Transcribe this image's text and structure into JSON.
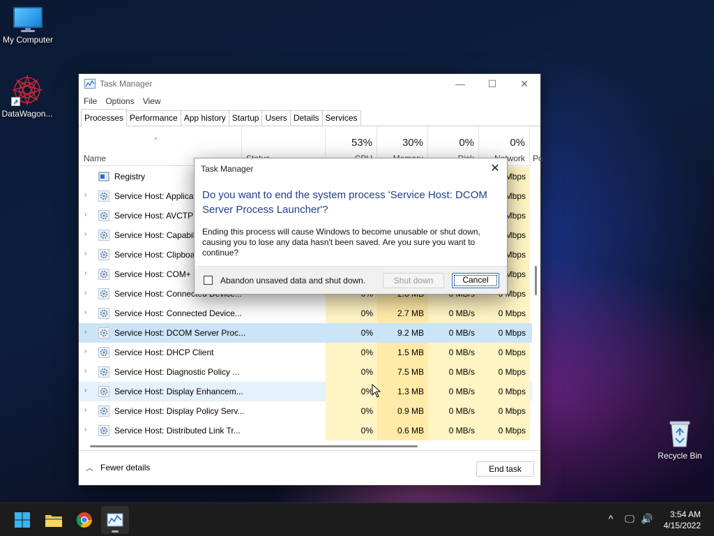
{
  "desktop": {
    "icons": [
      {
        "label": "My Computer",
        "icon": "monitor-icon"
      },
      {
        "label": "DataWagon...",
        "icon": "datawagon-icon"
      },
      {
        "label": "Recycle Bin",
        "icon": "recycle-bin-icon"
      }
    ]
  },
  "task_manager": {
    "title": "Task Manager",
    "controls": {
      "minimize": "—",
      "maximize": "☐",
      "close": "✕"
    },
    "menu": [
      "File",
      "Options",
      "View"
    ],
    "tabs": [
      "Processes",
      "Performance",
      "App history",
      "Startup",
      "Users",
      "Details",
      "Services"
    ],
    "active_tab": "Processes",
    "columns": {
      "name": "Name",
      "status": "Status",
      "cpu": {
        "pct": "53%",
        "label": "CPU"
      },
      "memory": {
        "pct": "30%",
        "label": "Memory"
      },
      "disk": {
        "pct": "0%",
        "label": "Disk"
      },
      "network": {
        "pct": "0%",
        "label": "Network"
      },
      "power": "Po"
    },
    "rows": [
      {
        "name": "Registry",
        "cpu": "",
        "mem": "",
        "disk": "",
        "net": "Mbps",
        "expand": ""
      },
      {
        "name": "Service Host: Applicat",
        "cpu": "",
        "mem": "",
        "disk": "",
        "net": "Mbps",
        "expand": "›"
      },
      {
        "name": "Service Host: AVCTP s",
        "cpu": "",
        "mem": "",
        "disk": "",
        "net": "Mbps",
        "expand": "›"
      },
      {
        "name": "Service Host: Capabili",
        "cpu": "",
        "mem": "",
        "disk": "",
        "net": "Mbps",
        "expand": "›"
      },
      {
        "name": "Service Host: Clipboa",
        "cpu": "",
        "mem": "",
        "disk": "",
        "net": "Mbps",
        "expand": "›"
      },
      {
        "name": "Service Host: COM+ E",
        "cpu": "",
        "mem": "",
        "disk": "",
        "net": "Mbps",
        "expand": "›"
      },
      {
        "name": "Service Host: Connected Device...",
        "cpu": "0%",
        "mem": "2.8 MB",
        "disk": "0 MB/s",
        "net": "0 Mbps",
        "expand": "›"
      },
      {
        "name": "Service Host: Connected Device...",
        "cpu": "0%",
        "mem": "2.7 MB",
        "disk": "0 MB/s",
        "net": "0 Mbps",
        "expand": "›"
      },
      {
        "name": "Service Host: DCOM Server Proc...",
        "cpu": "0%",
        "mem": "9.2 MB",
        "disk": "0 MB/s",
        "net": "0 Mbps",
        "expand": "›"
      },
      {
        "name": "Service Host: DHCP Client",
        "cpu": "0%",
        "mem": "1.5 MB",
        "disk": "0 MB/s",
        "net": "0 Mbps",
        "expand": "›"
      },
      {
        "name": "Service Host: Diagnostic Policy ...",
        "cpu": "0%",
        "mem": "7.5 MB",
        "disk": "0 MB/s",
        "net": "0 Mbps",
        "expand": "›"
      },
      {
        "name": "Service Host: Display Enhancem...",
        "cpu": "0%",
        "mem": "1.3 MB",
        "disk": "0 MB/s",
        "net": "0 Mbps",
        "expand": "›"
      },
      {
        "name": "Service Host: Display Policy Serv...",
        "cpu": "0%",
        "mem": "0.9 MB",
        "disk": "0 MB/s",
        "net": "0 Mbps",
        "expand": "›"
      },
      {
        "name": "Service Host: Distributed Link Tr...",
        "cpu": "0%",
        "mem": "0.6 MB",
        "disk": "0 MB/s",
        "net": "0 Mbps",
        "expand": "›"
      }
    ],
    "selected_row": 8,
    "hover_row": 11,
    "footer": {
      "fewer_details": "Fewer details",
      "end_task": "End task"
    }
  },
  "dialog": {
    "title": "Task Manager",
    "close": "✕",
    "heading": "Do you want to end the system process 'Service Host: DCOM Server Process Launcher'?",
    "body": "Ending this process will cause Windows to become unusable or shut down, causing you to lose any data hasn't been saved. Are you sure you want to continue?",
    "checkbox_label": "Abandon unsaved data and shut down.",
    "shutdown_label": "Shut down",
    "cancel_label": "Cancel"
  },
  "taskbar": {
    "apps": [
      "start-icon",
      "file-explorer-icon",
      "chrome-icon",
      "task-manager-icon"
    ],
    "tray": {
      "chevron": "^",
      "network": "🖵",
      "volume": "🔊"
    },
    "time": "3:54 AM",
    "date": "4/15/2022"
  }
}
